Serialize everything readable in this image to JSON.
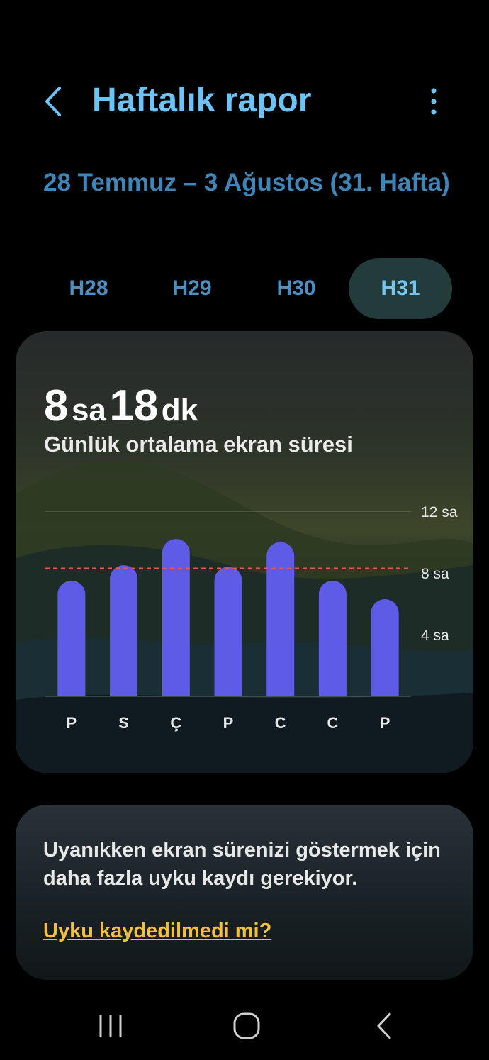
{
  "header": {
    "title": "Haftalık rapor",
    "back_icon": "chevron-left-icon",
    "more_icon": "more-vertical-icon"
  },
  "week": {
    "title": "28 Temmuz – 3 Ağustos (31. Hafta)"
  },
  "tabs": [
    {
      "label": "H28",
      "active": false
    },
    {
      "label": "H29",
      "active": false
    },
    {
      "label": "H30",
      "active": false
    },
    {
      "label": "H31",
      "active": true
    }
  ],
  "summary": {
    "hours": "8",
    "hours_unit": "sa",
    "minutes": "18",
    "minutes_unit": "dk",
    "label": "Günlük ortalama ekran süresi"
  },
  "chart_data": {
    "type": "bar",
    "categories": [
      "P",
      "S",
      "Ç",
      "P",
      "C",
      "C",
      "P"
    ],
    "values": [
      7.5,
      8.5,
      10.2,
      8.4,
      10.0,
      7.5,
      6.3
    ],
    "ylim": [
      0,
      12
    ],
    "yticks": [
      4,
      8,
      12
    ],
    "ytick_labels": [
      "4 sa",
      "8 sa",
      "12 sa"
    ],
    "average": 8.3,
    "bar_color": "#5e5ce6",
    "average_line_color": "#e15a4a",
    "grid": true
  },
  "sleep_card": {
    "message": "Uyanıkken ekran sürenizi göstermek için daha fazla uyku kaydı gerekiyor.",
    "link": "Uyku kaydedilmedi mi?"
  },
  "navbar": {
    "recent_icon": "recent-apps-icon",
    "home_icon": "home-icon",
    "back_icon": "back-icon"
  },
  "colors": {
    "accent": "#6cc3f5",
    "link": "#f3c03b",
    "active_tab_bg": "#233b3a"
  }
}
